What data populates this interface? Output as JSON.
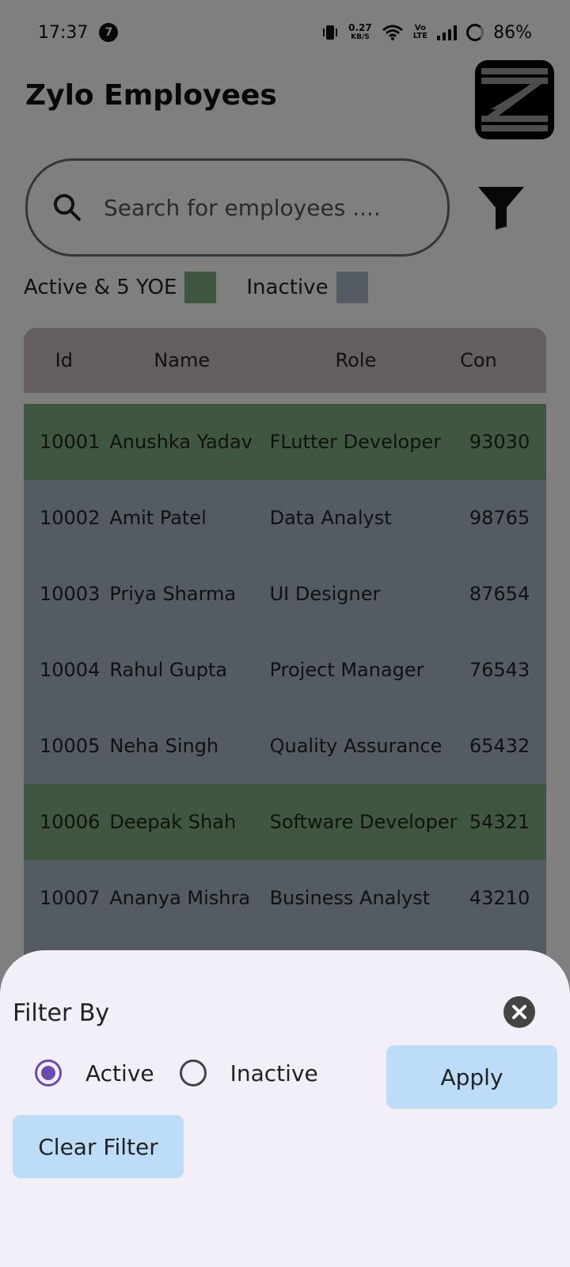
{
  "status_bar": {
    "time": "17:37",
    "notification_count": "7",
    "net_speed_value": "0.27",
    "net_speed_unit": "KB/S",
    "volte_top": "Vo",
    "volte_bottom": "LTE",
    "battery": "86%"
  },
  "header": {
    "title": "Zylo Employees"
  },
  "search": {
    "placeholder": "Search for employees ...."
  },
  "legend": {
    "active_label": "Active & 5 YOE",
    "active_color": "#7faf80",
    "inactive_label": "Inactive",
    "inactive_color": "#a9b7c6"
  },
  "table": {
    "headers": {
      "id": "Id",
      "name": "Name",
      "role": "Role",
      "contact": "Con"
    },
    "rows": [
      {
        "id": "10001",
        "name": "Anushka Yadav",
        "role": "FLutter Developer",
        "contact": "93030",
        "status": "active"
      },
      {
        "id": "10002",
        "name": "Amit Patel",
        "role": "Data Analyst",
        "contact": "98765",
        "status": "inactive"
      },
      {
        "id": "10003",
        "name": "Priya Sharma",
        "role": "UI Designer",
        "contact": "87654",
        "status": "inactive"
      },
      {
        "id": "10004",
        "name": "Rahul Gupta",
        "role": "Project Manager",
        "contact": "76543",
        "status": "inactive"
      },
      {
        "id": "10005",
        "name": "Neha Singh",
        "role": "Quality Assurance",
        "contact": "65432",
        "status": "inactive"
      },
      {
        "id": "10006",
        "name": "Deepak Shah",
        "role": "Software Developer",
        "contact": "54321",
        "status": "active"
      },
      {
        "id": "10007",
        "name": "Ananya Mishra",
        "role": "Business Analyst",
        "contact": "43210",
        "status": "inactive"
      },
      {
        "id": "",
        "name": "",
        "role": "",
        "contact": "",
        "status": "inactive"
      }
    ]
  },
  "filter_sheet": {
    "title": "Filter By",
    "options": [
      {
        "label": "Active",
        "selected": true
      },
      {
        "label": "Inactive",
        "selected": false
      }
    ],
    "apply_label": "Apply",
    "clear_label": "Clear Filter",
    "accent_color": "#6a4cb0",
    "button_color": "#bcdcf7"
  }
}
